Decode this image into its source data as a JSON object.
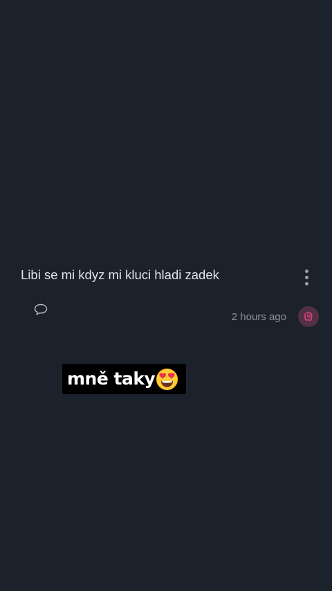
{
  "post": {
    "text": "Libi se mi kdyz mi kluci hladi zadek",
    "timestamp": "2 hours ago",
    "menu_icon": "vertical-ellipsis-icon",
    "comment_icon": "speech-bubble-icon",
    "avatar_icon": "pink-blob-avatar-icon",
    "colors": {
      "background": "#1c222c",
      "text": "#e3e5e8",
      "muted": "#8d929a",
      "avatar_bg": "#533044",
      "avatar_fg": "#e0457f"
    }
  },
  "sticker": {
    "text": "mně taky",
    "emoji": "heart-eyes-emoji",
    "background": "#000000"
  }
}
